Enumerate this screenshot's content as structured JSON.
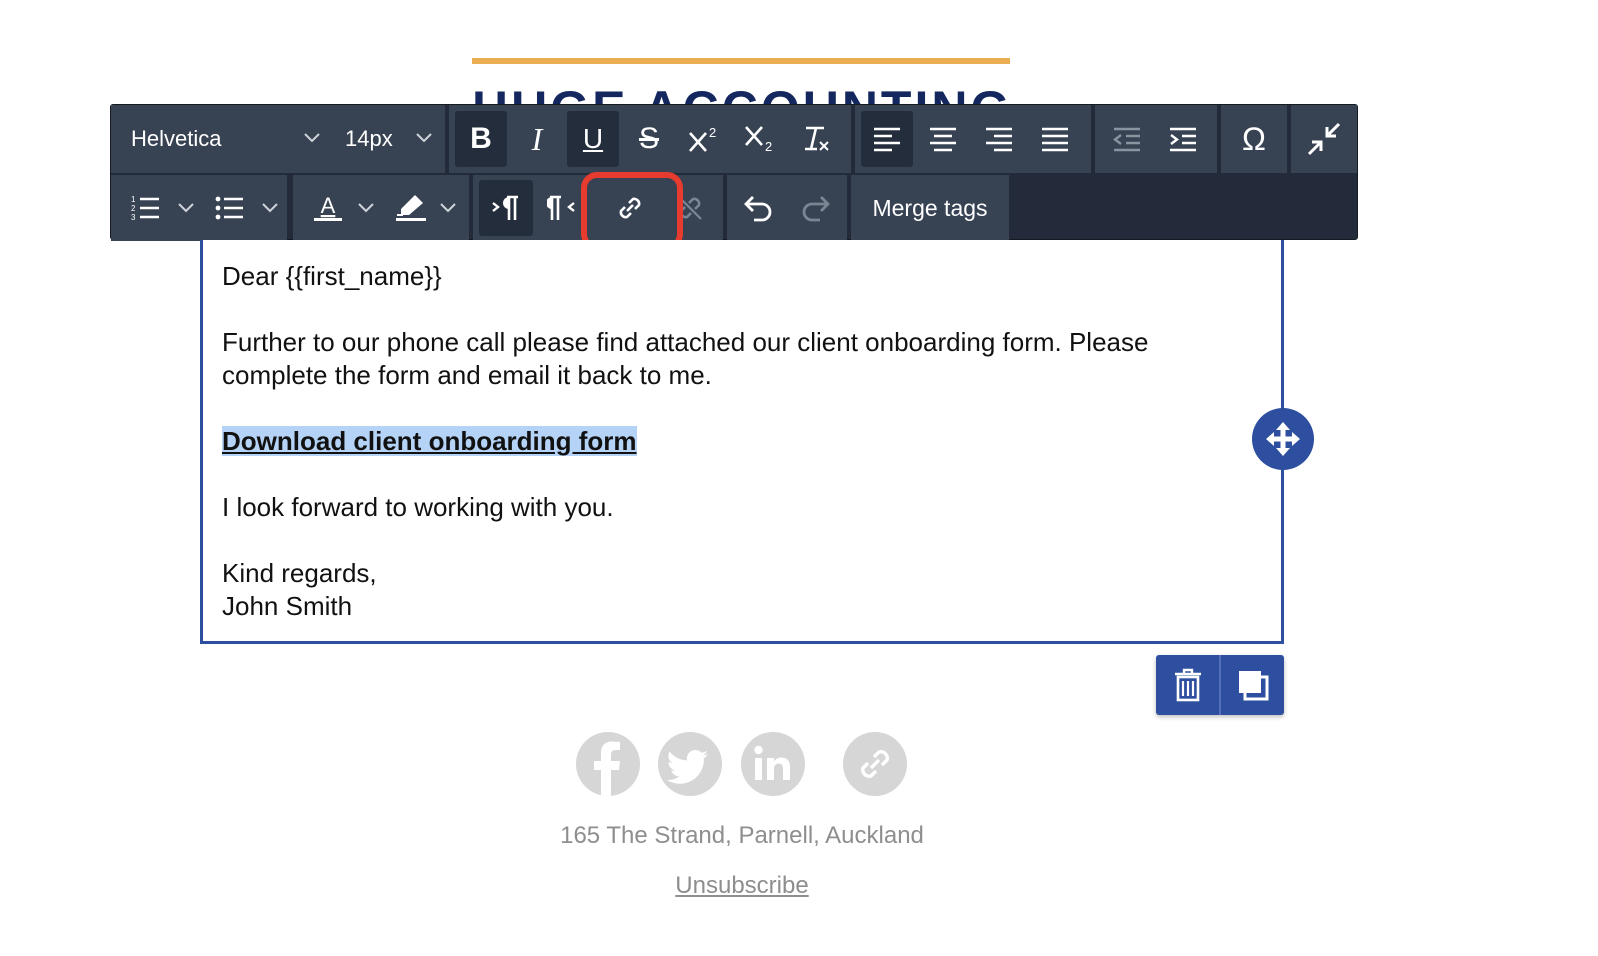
{
  "header": {
    "logo_text": "HUGE ACCOUNTING",
    "accent_color": "#e9ae52",
    "brand_color": "#14285f"
  },
  "toolbar": {
    "font_family": "Helvetica",
    "font_size": "14px",
    "merge_tags_label": "Merge tags",
    "bold_label": "B",
    "italic_label": "I",
    "underline_label": "U",
    "strike_label": "S",
    "omega_label": "Ω",
    "theme_color": "#232b3a"
  },
  "editor": {
    "greeting": "Dear {{first_name}}",
    "para1_line1": "Further to our phone call please find attached our client onboarding form. Please",
    "para1_line2": "complete the form and email it back to me.",
    "link_text": "Download client onboarding form",
    "closing": "I look forward to working with you.",
    "signoff": "Kind regards,",
    "signature": "John Smith",
    "border_color": "#2e4f9f",
    "selection_color": "#b5d3f6"
  },
  "footer": {
    "address": "165 The Strand, Parnell, Auckland",
    "unsubscribe": "Unsubscribe",
    "social_icons": [
      "facebook-icon",
      "twitter-icon",
      "linkedin-icon",
      "link-icon"
    ]
  },
  "annotation": {
    "highlight_color": "#e63b2e",
    "target": "insert-link-button"
  }
}
